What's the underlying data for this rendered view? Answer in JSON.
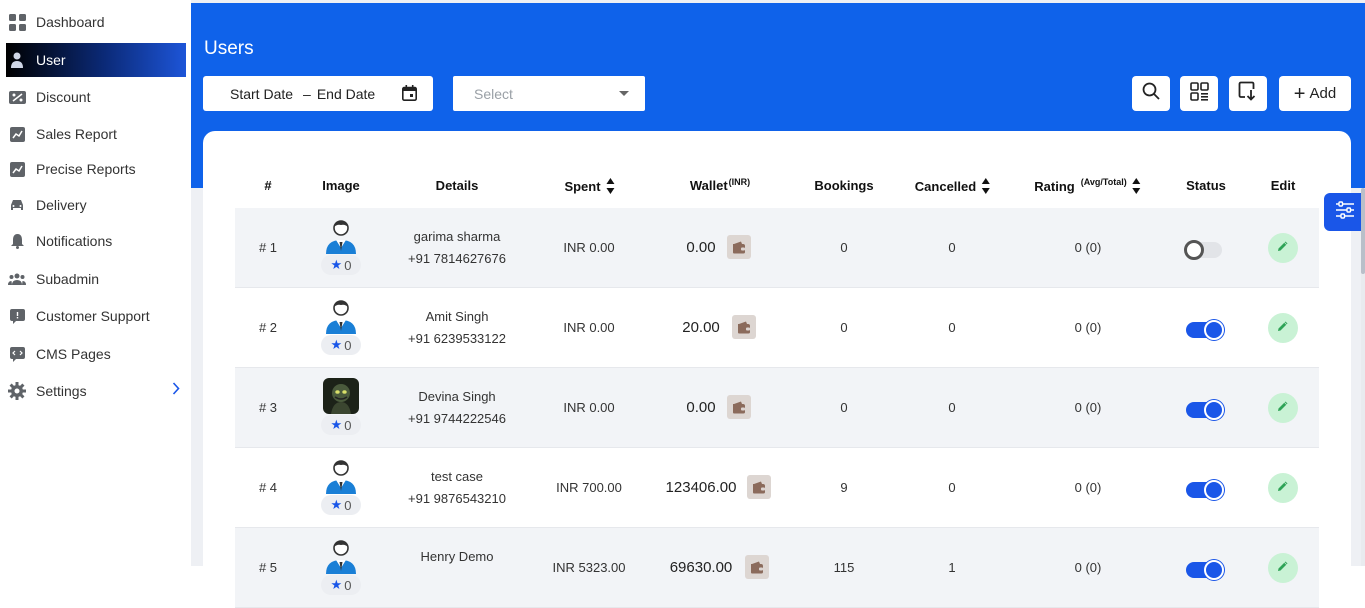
{
  "sidebar": {
    "items": [
      {
        "label": "Dashboard",
        "icon": "dashboard-icon"
      },
      {
        "label": "User",
        "icon": "user-icon",
        "active": true
      },
      {
        "label": "Discount",
        "icon": "discount-icon"
      },
      {
        "label": "Sales Report",
        "icon": "sales-report-icon"
      },
      {
        "label": "Precise Reports",
        "icon": "precise-reports-icon"
      },
      {
        "label": "Delivery",
        "icon": "delivery-car-icon"
      },
      {
        "label": "Notifications",
        "icon": "bell-icon"
      },
      {
        "label": "Subadmin",
        "icon": "group-icon"
      },
      {
        "label": "Customer Support",
        "icon": "support-chat-icon"
      },
      {
        "label": "CMS Pages",
        "icon": "cms-icon"
      },
      {
        "label": "Settings",
        "icon": "gear-icon",
        "has_chevron": true
      }
    ]
  },
  "header": {
    "title": "Users",
    "date_start": "Start Date",
    "date_separator": "–",
    "date_end": "End Date",
    "select_placeholder": "Select",
    "add_label": "Add"
  },
  "table": {
    "columns": [
      "#",
      "Image",
      "Details",
      "Spent",
      "Wallet",
      "Bookings",
      "Cancelled",
      "Rating",
      "Status",
      "Edit"
    ],
    "wallet_sup": "(INR)",
    "rating_sup": "(Avg/Total)",
    "rows": [
      {
        "num": "# 1",
        "rating_badge": "0",
        "name": "garima sharma",
        "phone": "+91 7814627676",
        "spent": "INR 0.00",
        "wallet": "0.00",
        "bookings": "0",
        "cancelled": "0",
        "rating": "0 (0)",
        "status_on": false,
        "photo": false
      },
      {
        "num": "# 2",
        "rating_badge": "0",
        "name": "Amit Singh",
        "phone": "+91 6239533122",
        "spent": "INR 0.00",
        "wallet": "20.00",
        "bookings": "0",
        "cancelled": "0",
        "rating": "0 (0)",
        "status_on": true,
        "photo": false
      },
      {
        "num": "# 3",
        "rating_badge": "0",
        "name": "Devina Singh",
        "phone": "+91 9744222546",
        "spent": "INR 0.00",
        "wallet": "0.00",
        "bookings": "0",
        "cancelled": "0",
        "rating": "0 (0)",
        "status_on": true,
        "photo": true
      },
      {
        "num": "# 4",
        "rating_badge": "0",
        "name": "test case",
        "phone": "+91 9876543210",
        "spent": "INR 700.00",
        "wallet": "123406.00",
        "bookings": "9",
        "cancelled": "0",
        "rating": "0 (0)",
        "status_on": true,
        "photo": false
      },
      {
        "num": "# 5",
        "rating_badge": "0",
        "name": "Henry Demo",
        "phone": "",
        "spent": "INR 5323.00",
        "wallet": "69630.00",
        "bookings": "115",
        "cancelled": "1",
        "rating": "0 (0)",
        "status_on": true,
        "photo": false
      }
    ]
  },
  "colors": {
    "primary": "#0f62ea",
    "accent": "#1a56e8",
    "edit_bg": "#c9f2d5"
  }
}
